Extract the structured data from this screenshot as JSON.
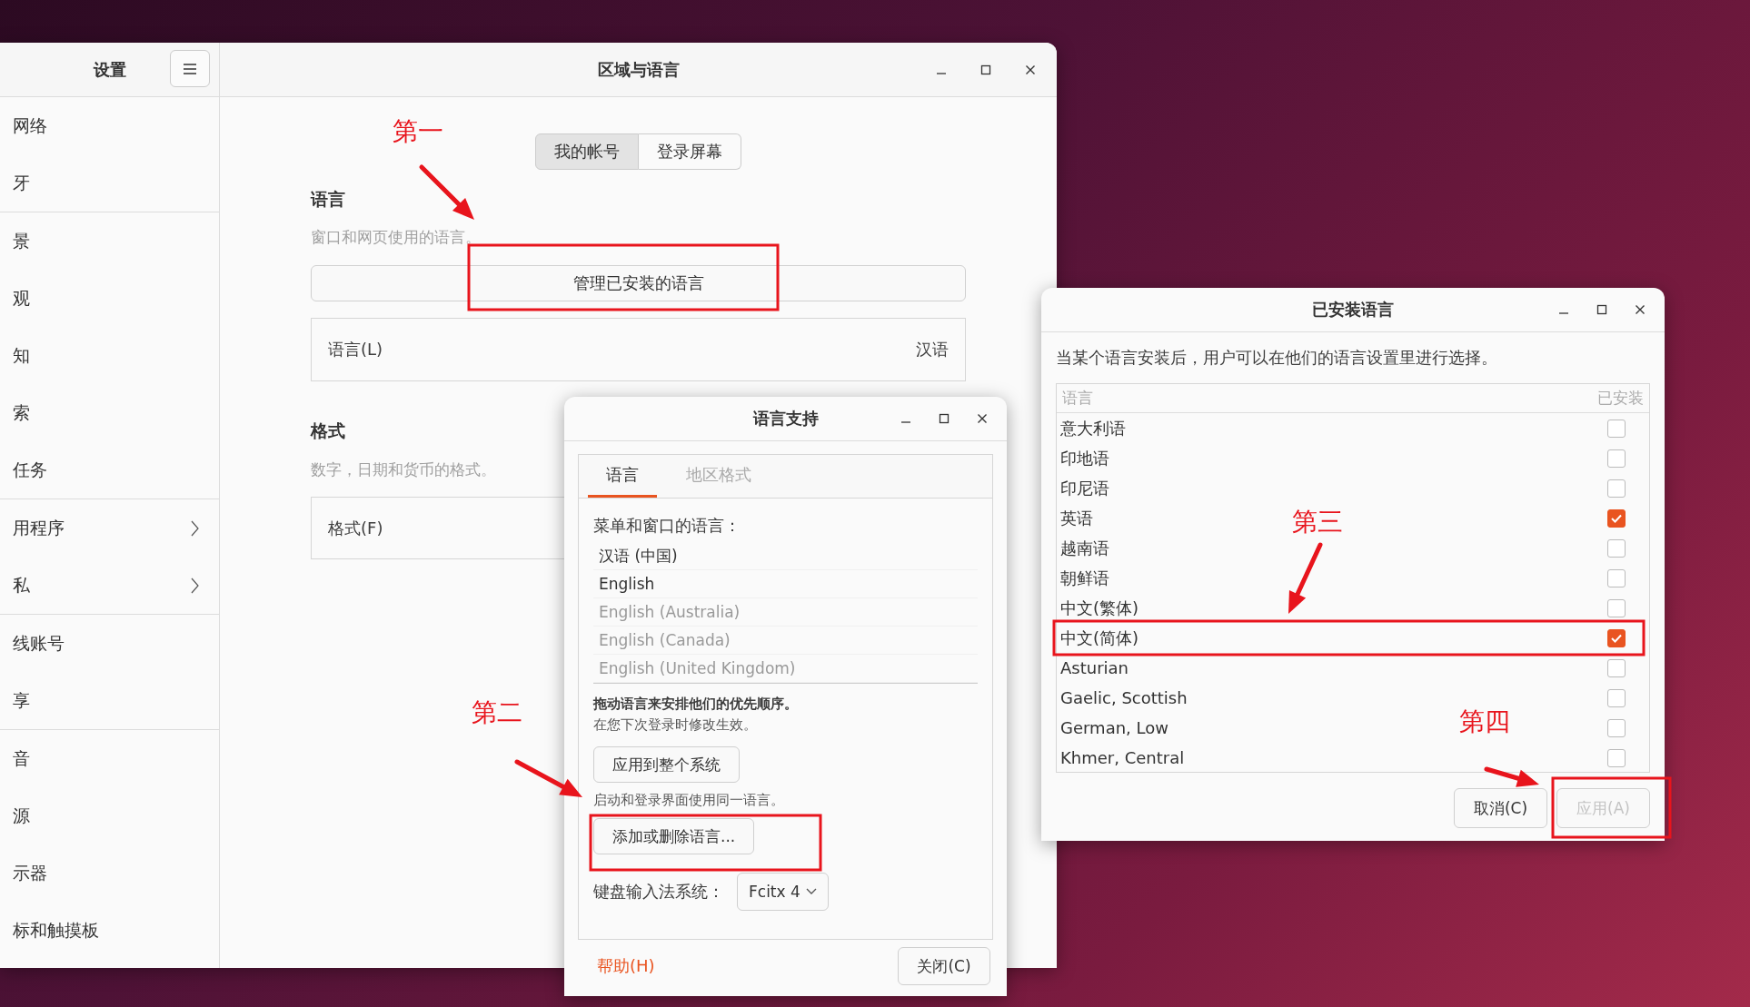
{
  "settings_window": {
    "sidebar": {
      "title": "设置",
      "groups": [
        [
          {
            "label": "网络",
            "submenu": false
          },
          {
            "label": "牙",
            "submenu": false
          }
        ],
        [
          {
            "label": "景",
            "submenu": false
          },
          {
            "label": "观",
            "submenu": false
          },
          {
            "label": "知",
            "submenu": false
          },
          {
            "label": "索",
            "submenu": false
          },
          {
            "label": "任务",
            "submenu": false
          }
        ],
        [
          {
            "label": "用程序",
            "submenu": true
          },
          {
            "label": "私",
            "submenu": true
          }
        ],
        [
          {
            "label": "线账号",
            "submenu": false
          },
          {
            "label": "享",
            "submenu": false
          }
        ],
        [
          {
            "label": "音",
            "submenu": false
          },
          {
            "label": "源",
            "submenu": false
          },
          {
            "label": "示器",
            "submenu": false
          },
          {
            "label": "标和触摸板",
            "submenu": false
          }
        ]
      ]
    },
    "title": "区域与语言",
    "tabs": [
      {
        "label": "我的帐号",
        "selected": true
      },
      {
        "label": "登录屏幕",
        "selected": false
      }
    ],
    "language_section": {
      "heading": "语言",
      "description": "窗口和网页使用的语言。",
      "manage_button": "管理已安装的语言",
      "row": {
        "label": "语言(L)",
        "value": "汉语"
      }
    },
    "format_section": {
      "heading": "格式",
      "description": "数字，日期和货币的格式。",
      "row": {
        "label": "格式(F)"
      }
    }
  },
  "language_support_dialog": {
    "title": "语言支持",
    "tabs": [
      {
        "label": "语言",
        "selected": true
      },
      {
        "label": "地区格式",
        "selected": false
      }
    ],
    "list_label": "菜单和窗口的语言：",
    "languages": [
      {
        "label": "汉语 (中国)",
        "dimmed": false
      },
      {
        "label": "English",
        "dimmed": false
      },
      {
        "label": "English (Australia)",
        "dimmed": true
      },
      {
        "label": "English (Canada)",
        "dimmed": true
      },
      {
        "label": "English (United Kingdom)",
        "dimmed": true
      }
    ],
    "hint_bold": "拖动语言来安排他们的优先顺序。",
    "hint": "在您下次登录时修改生效。",
    "apply_system_button": "应用到整个系统",
    "note": "启动和登录界面使用同一语言。",
    "add_remove_button": "添加或删除语言...",
    "input_method": {
      "label": "键盘输入法系统：",
      "value": "Fcitx 4"
    },
    "help_link": "帮助(H)",
    "close_button": "关闭(C)"
  },
  "installed_languages_dialog": {
    "title": "已安装语言",
    "description": "当某个语言安装后，用户可以在他们的语言设置里进行选择。",
    "columns": [
      "语言",
      "已安装"
    ],
    "rows": [
      {
        "language": "意大利语",
        "installed": false
      },
      {
        "language": "印地语",
        "installed": false
      },
      {
        "language": "印尼语",
        "installed": false
      },
      {
        "language": "英语",
        "installed": true
      },
      {
        "language": "越南语",
        "installed": false
      },
      {
        "language": "朝鲜语",
        "installed": false
      },
      {
        "language": "中文(繁体)",
        "installed": false
      },
      {
        "language": "中文(简体)",
        "installed": true
      },
      {
        "language": "Asturian",
        "installed": false
      },
      {
        "language": "Gaelic, Scottish",
        "installed": false
      },
      {
        "language": "German, Low",
        "installed": false
      },
      {
        "language": "Khmer, Central",
        "installed": false
      }
    ],
    "buttons": [
      {
        "label": "取消(C)",
        "disabled": false
      },
      {
        "label": "应用(A)",
        "disabled": true
      }
    ]
  },
  "annotations": [
    {
      "label": "第一"
    },
    {
      "label": "第二"
    },
    {
      "label": "第三"
    },
    {
      "label": "第四"
    }
  ]
}
